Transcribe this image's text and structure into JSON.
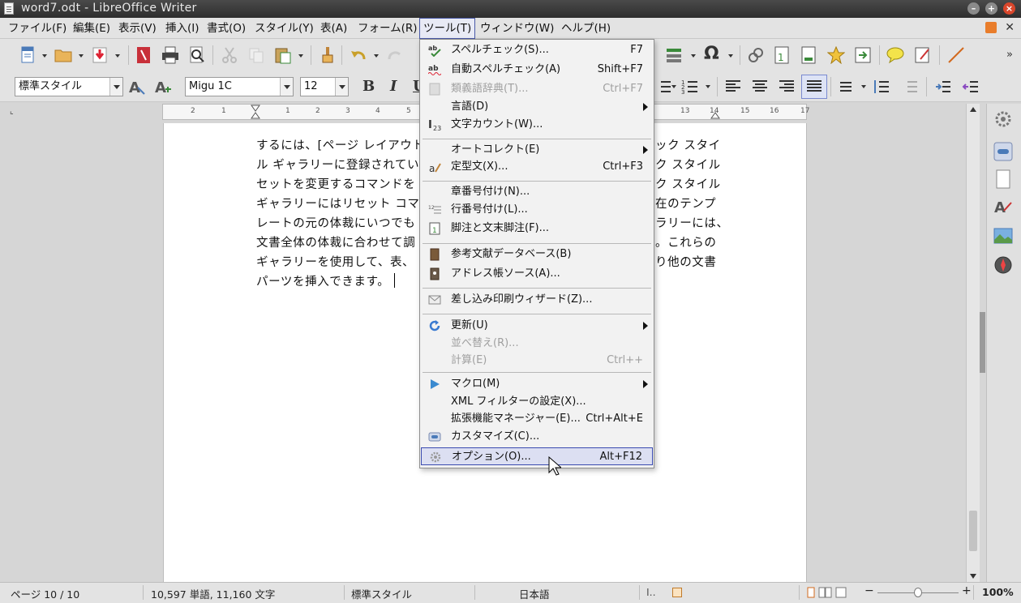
{
  "window": {
    "title": "word7.odt - LibreOffice Writer"
  },
  "menubar": [
    {
      "label": "ファイル(F)"
    },
    {
      "label": "編集(E)"
    },
    {
      "label": "表示(V)"
    },
    {
      "label": "挿入(I)"
    },
    {
      "label": "書式(O)"
    },
    {
      "label": "スタイル(Y)"
    },
    {
      "label": "表(A)"
    },
    {
      "label": "フォーム(R)"
    },
    {
      "label": "ツール(T)"
    },
    {
      "label": "ウィンドウ(W)"
    },
    {
      "label": "ヘルプ(H)"
    }
  ],
  "formatting": {
    "paragraph_style": "標準スタイル",
    "font_name": "Migu 1C",
    "font_size": "12",
    "bold": "B",
    "italic": "I",
    "underline": "U"
  },
  "ruler": {
    "left_numbers": [
      "2",
      "1",
      "1",
      "2",
      "3",
      "4",
      "5"
    ],
    "right_numbers": [
      "13",
      "14",
      "15",
      "16",
      "17"
    ]
  },
  "document": {
    "lines": [
      "するには、[ページ レイアウト",
      "ル ギャラリーに登録されてい",
      "セットを変更するコマンドを",
      "ギャラリーにはリセット コマン",
      "レートの元の体裁にいつでも",
      "文書全体の体裁に合わせて調",
      "ギャラリーを使用して、表、",
      "パーツを挿入できます。"
    ],
    "right_fragments": [
      "ック スタイ",
      "ク スタイル",
      "ク スタイル",
      "在のテンプ",
      "ラリーには、",
      "。これらの",
      "り他の文書"
    ]
  },
  "tools_menu": {
    "items": [
      {
        "label": "スペルチェック(S)...",
        "shortcut": "F7",
        "icon": "spellcheck-icon",
        "disabled": false
      },
      {
        "label": "自動スペルチェック(A)",
        "shortcut": "Shift+F7",
        "icon": "auto-spellcheck-icon",
        "disabled": false
      },
      {
        "label": "類義語辞典(T)...",
        "shortcut": "Ctrl+F7",
        "icon": "thesaurus-icon",
        "disabled": true
      },
      {
        "label": "言語(D)",
        "shortcut": "",
        "icon": "",
        "disabled": false,
        "submenu": true
      },
      {
        "label": "文字カウント(W)...",
        "shortcut": "",
        "icon": "word-count-icon",
        "disabled": false
      },
      {
        "label": "オートコレクト(E)",
        "shortcut": "",
        "icon": "",
        "disabled": false,
        "submenu": true
      },
      {
        "label": "定型文(X)...",
        "shortcut": "Ctrl+F3",
        "icon": "autotext-icon",
        "disabled": false
      },
      {
        "label": "章番号付け(N)...",
        "shortcut": "",
        "icon": "",
        "disabled": false
      },
      {
        "label": "行番号付け(L)...",
        "shortcut": "",
        "icon": "line-numbering-icon",
        "disabled": false
      },
      {
        "label": "脚注と文末脚注(F)...",
        "shortcut": "",
        "icon": "footnote-icon",
        "disabled": false
      },
      {
        "label": "参考文献データベース(B)",
        "shortcut": "",
        "icon": "bibliography-icon",
        "disabled": false
      },
      {
        "label": "アドレス帳ソース(A)...",
        "shortcut": "",
        "icon": "address-book-icon",
        "disabled": false
      },
      {
        "label": "差し込み印刷ウィザード(Z)...",
        "shortcut": "",
        "icon": "mail-merge-icon",
        "disabled": false
      },
      {
        "label": "更新(U)",
        "shortcut": "",
        "icon": "update-icon",
        "disabled": false,
        "submenu": true
      },
      {
        "label": "並べ替え(R)...",
        "shortcut": "",
        "icon": "",
        "disabled": true
      },
      {
        "label": "計算(E)",
        "shortcut": "Ctrl++",
        "icon": "",
        "disabled": true
      },
      {
        "label": "マクロ(M)",
        "shortcut": "",
        "icon": "macro-icon",
        "disabled": false,
        "submenu": true
      },
      {
        "label": "XML フィルターの設定(X)...",
        "shortcut": "",
        "icon": "",
        "disabled": false
      },
      {
        "label": "拡張機能マネージャー(E)...",
        "shortcut": "Ctrl+Alt+E",
        "icon": "",
        "disabled": false
      },
      {
        "label": "カスタマイズ(C)...",
        "shortcut": "",
        "icon": "customize-icon",
        "disabled": false
      },
      {
        "label": "オプション(O)...",
        "shortcut": "Alt+F12",
        "icon": "options-gear-icon",
        "disabled": false,
        "selected": true
      }
    ]
  },
  "statusbar": {
    "page": "ページ 10 / 10",
    "words": "10,597 単語, 11,160 文字",
    "style": "標準スタイル",
    "language": "日本語",
    "insert_mode": "I..",
    "zoom": "100%"
  },
  "colors": {
    "accent": "#3b4bb0",
    "menu_bg": "#f2f2f2",
    "toolbar_bg": "#e3e3e3",
    "close_button": "#d9462b"
  }
}
